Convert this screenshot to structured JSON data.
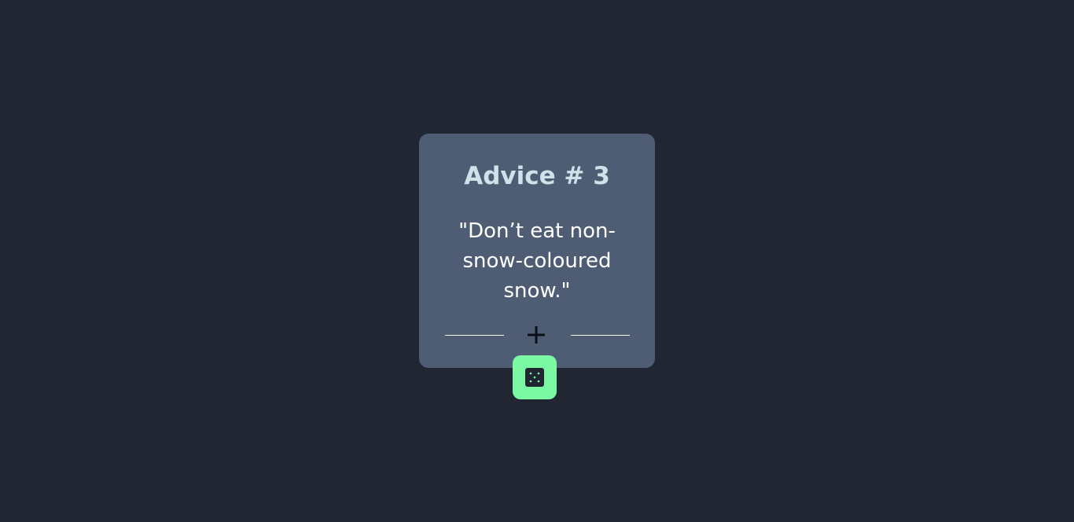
{
  "advice": {
    "heading": "Advice # 3",
    "quote": "\"Don’t eat non-snow-coloured snow.\""
  },
  "icons": {
    "divider_center": "plus-icon",
    "generate_button": "dice-icon"
  },
  "colors": {
    "background": "#202632",
    "card": "#4f5d74",
    "heading": "#cee3e9",
    "quote": "#ffffff",
    "accent": "#7cf7a4",
    "dice": "#202632"
  }
}
